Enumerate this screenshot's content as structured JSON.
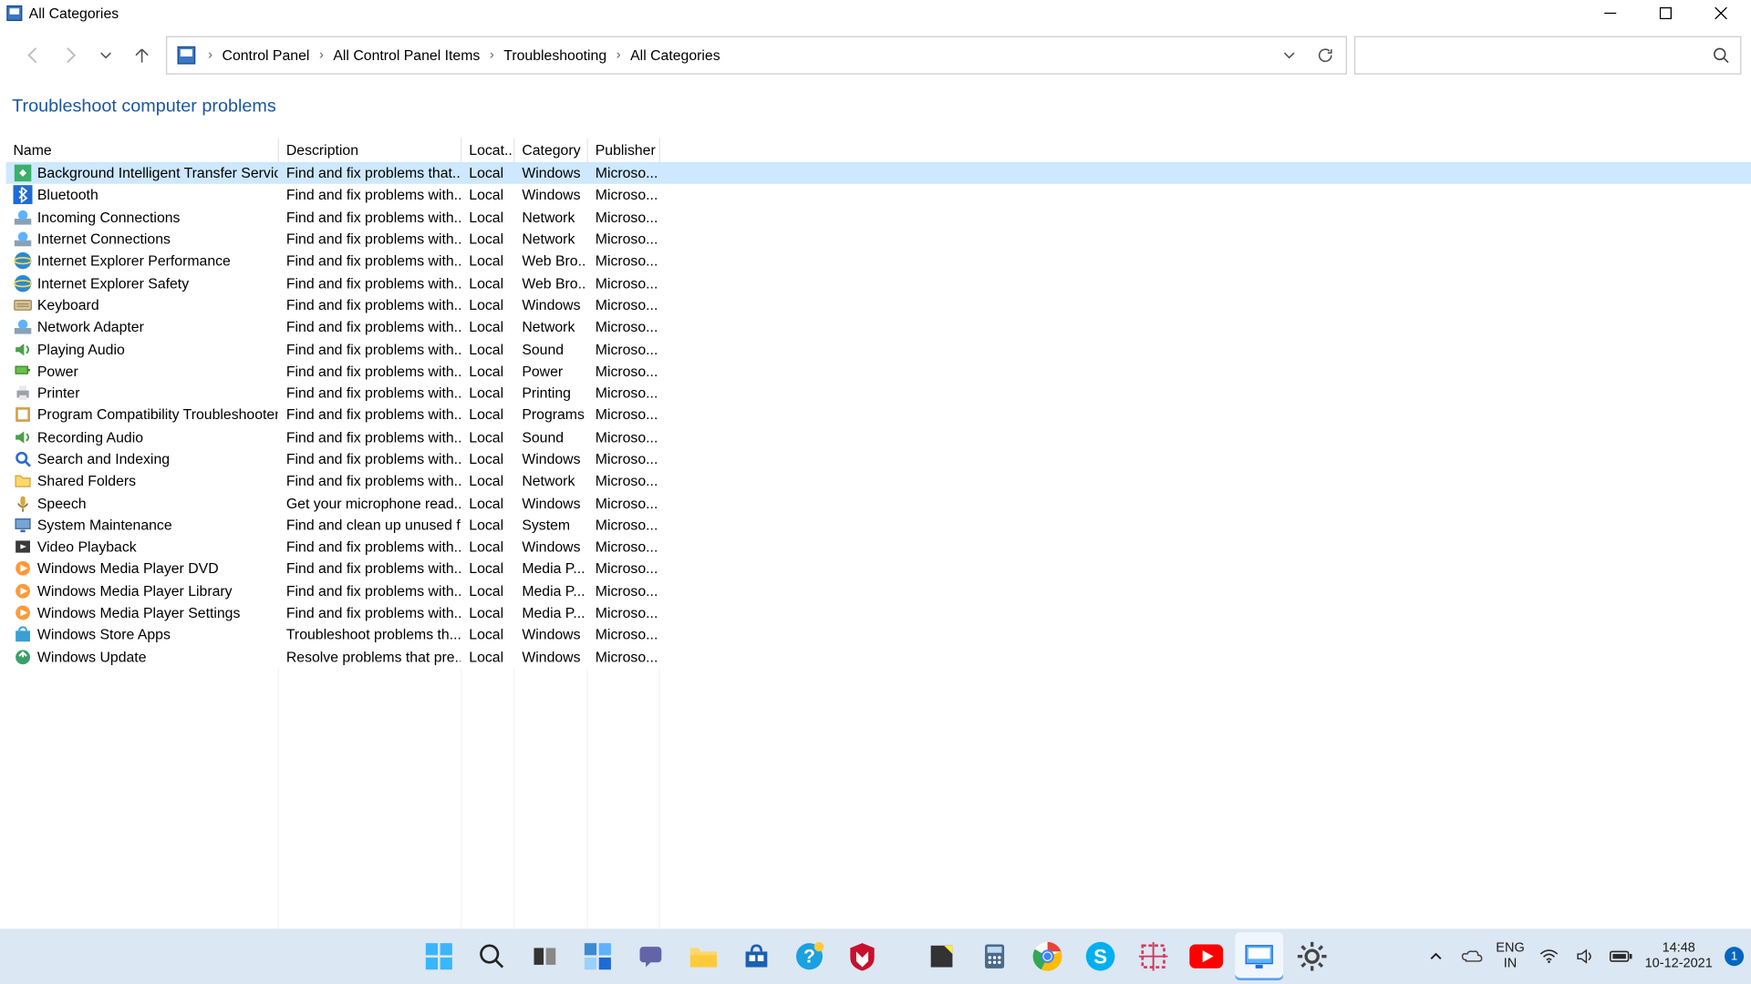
{
  "window": {
    "title": "All Categories"
  },
  "breadcrumb": [
    "Control Panel",
    "All Control Panel Items",
    "Troubleshooting",
    "All Categories"
  ],
  "search": {
    "placeholder": ""
  },
  "heading": "Troubleshoot computer problems",
  "columns": {
    "name": "Name",
    "description": "Description",
    "location": "Locat...",
    "category": "Category",
    "publisher": "Publisher"
  },
  "rows": [
    {
      "name": "Background Intelligent Transfer Service",
      "description": "Find and fix problems that...",
      "location": "Local",
      "category": "Windows",
      "publisher": "Microso...",
      "selected": true,
      "icon": "bits"
    },
    {
      "name": "Bluetooth",
      "description": "Find and fix problems with...",
      "location": "Local",
      "category": "Windows",
      "publisher": "Microso...",
      "icon": "bluetooth"
    },
    {
      "name": "Incoming Connections",
      "description": "Find and fix problems with...",
      "location": "Local",
      "category": "Network",
      "publisher": "Microso...",
      "icon": "net"
    },
    {
      "name": "Internet Connections",
      "description": "Find and fix problems with...",
      "location": "Local",
      "category": "Network",
      "publisher": "Microso...",
      "icon": "net"
    },
    {
      "name": "Internet Explorer Performance",
      "description": "Find and fix problems with...",
      "location": "Local",
      "category": "Web Bro...",
      "publisher": "Microso...",
      "icon": "ie"
    },
    {
      "name": "Internet Explorer Safety",
      "description": "Find and fix problems with...",
      "location": "Local",
      "category": "Web Bro...",
      "publisher": "Microso...",
      "icon": "ie"
    },
    {
      "name": "Keyboard",
      "description": "Find and fix problems with...",
      "location": "Local",
      "category": "Windows",
      "publisher": "Microso...",
      "icon": "kb"
    },
    {
      "name": "Network Adapter",
      "description": "Find and fix problems with...",
      "location": "Local",
      "category": "Network",
      "publisher": "Microso...",
      "icon": "net"
    },
    {
      "name": "Playing Audio",
      "description": "Find and fix problems with...",
      "location": "Local",
      "category": "Sound",
      "publisher": "Microso...",
      "icon": "audio"
    },
    {
      "name": "Power",
      "description": "Find and fix problems with...",
      "location": "Local",
      "category": "Power",
      "publisher": "Microso...",
      "icon": "power"
    },
    {
      "name": "Printer",
      "description": "Find and fix problems with...",
      "location": "Local",
      "category": "Printing",
      "publisher": "Microso...",
      "icon": "printer"
    },
    {
      "name": "Program Compatibility Troubleshooter",
      "description": "Find and fix problems with...",
      "location": "Local",
      "category": "Programs",
      "publisher": "Microso...",
      "icon": "program"
    },
    {
      "name": "Recording Audio",
      "description": "Find and fix problems with...",
      "location": "Local",
      "category": "Sound",
      "publisher": "Microso...",
      "icon": "audio"
    },
    {
      "name": "Search and Indexing",
      "description": "Find and fix problems with...",
      "location": "Local",
      "category": "Windows",
      "publisher": "Microso...",
      "icon": "search"
    },
    {
      "name": "Shared Folders",
      "description": "Find and fix problems with...",
      "location": "Local",
      "category": "Network",
      "publisher": "Microso...",
      "icon": "folder"
    },
    {
      "name": "Speech",
      "description": "Get your microphone read...",
      "location": "Local",
      "category": "Windows",
      "publisher": "Microso...",
      "icon": "mic"
    },
    {
      "name": "System Maintenance",
      "description": "Find and clean up unused f...",
      "location": "Local",
      "category": "System",
      "publisher": "Microso...",
      "icon": "sys"
    },
    {
      "name": "Video Playback",
      "description": "Find and fix problems with...",
      "location": "Local",
      "category": "Windows",
      "publisher": "Microso...",
      "icon": "video"
    },
    {
      "name": "Windows Media Player DVD",
      "description": "Find and fix problems with...",
      "location": "Local",
      "category": "Media P...",
      "publisher": "Microso...",
      "icon": "wmp"
    },
    {
      "name": "Windows Media Player Library",
      "description": "Find and fix problems with...",
      "location": "Local",
      "category": "Media P...",
      "publisher": "Microso...",
      "icon": "wmp"
    },
    {
      "name": "Windows Media Player Settings",
      "description": "Find and fix problems with...",
      "location": "Local",
      "category": "Media P...",
      "publisher": "Microso...",
      "icon": "wmp"
    },
    {
      "name": "Windows Store Apps",
      "description": "Troubleshoot problems th...",
      "location": "Local",
      "category": "Windows",
      "publisher": "Microso...",
      "icon": "store"
    },
    {
      "name": "Windows Update",
      "description": "Resolve problems that pre...",
      "location": "Local",
      "category": "Windows",
      "publisher": "Microso...",
      "icon": "update"
    }
  ],
  "taskbar": {
    "center": [
      "start",
      "search",
      "taskview",
      "widgets",
      "chat",
      "explorer",
      "store",
      "help",
      "mcafee",
      "",
      "notes",
      "calculator",
      "chrome",
      "skype",
      "snip",
      "youtube",
      "controlpanel",
      "settings"
    ],
    "tray": {
      "lang1": "ENG",
      "lang2": "IN",
      "time": "14:48",
      "date": "10-12-2021",
      "badge": "1"
    }
  }
}
